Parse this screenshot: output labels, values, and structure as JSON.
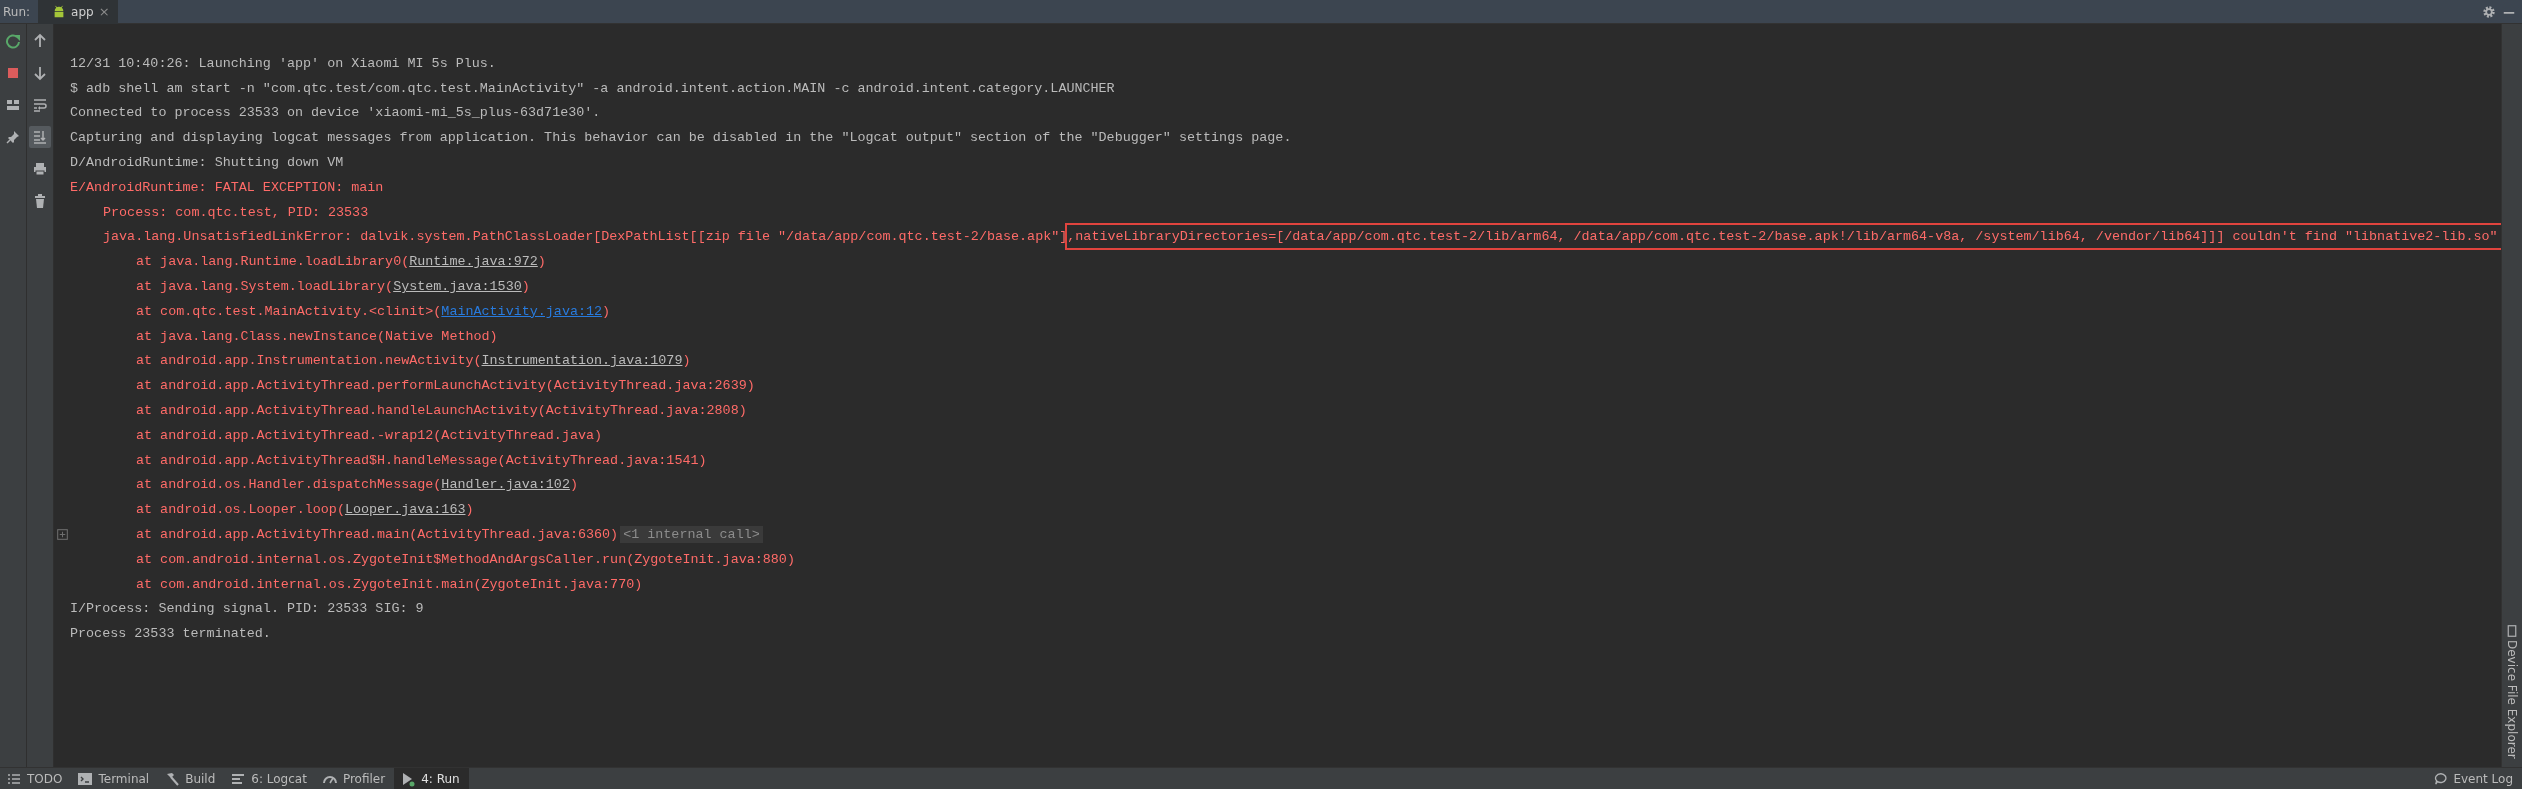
{
  "top_bar": {
    "label": "Run:",
    "tab": {
      "title": "app",
      "close": "×"
    }
  },
  "toolbar_left": [
    {
      "kind": "rerun",
      "selected": false
    },
    {
      "kind": "stop",
      "selected": false
    },
    {
      "kind": "layout",
      "selected": false
    },
    {
      "kind": "pin",
      "selected": false
    }
  ],
  "toolbar_right": [
    {
      "kind": "up",
      "selected": false
    },
    {
      "kind": "down",
      "selected": false
    },
    {
      "kind": "wrap",
      "selected": false
    },
    {
      "kind": "scroll-end",
      "selected": true
    },
    {
      "kind": "print",
      "selected": false
    },
    {
      "kind": "trash",
      "selected": false
    }
  ],
  "console": [
    {
      "kind": "info",
      "parts": [
        {
          "text": "12/31 10:40:26: Launching 'app' on Xiaomi MI 5s Plus."
        }
      ]
    },
    {
      "kind": "info",
      "parts": [
        {
          "text": "$ adb shell am start -n \"com.qtc.test/com.qtc.test.MainActivity\" -a android.intent.action.MAIN -c android.intent.category.LAUNCHER"
        }
      ]
    },
    {
      "kind": "info",
      "parts": [
        {
          "text": "Connected to process 23533 on device 'xiaomi-mi_5s_plus-63d71e30'."
        }
      ]
    },
    {
      "kind": "info",
      "parts": [
        {
          "text": "Capturing and displaying logcat messages from application. This behavior can be disabled in the \"Logcat output\" section of the \"Debugger\" settings page."
        }
      ]
    },
    {
      "kind": "info",
      "parts": [
        {
          "text": "D/AndroidRuntime: Shutting down VM"
        }
      ]
    },
    {
      "kind": "error",
      "parts": [
        {
          "text": "E/AndroidRuntime: FATAL EXCEPTION: main"
        }
      ]
    },
    {
      "kind": "detail",
      "parts": [
        {
          "text": "Process: com.qtc.test, PID: 23533"
        }
      ]
    },
    {
      "kind": "detail",
      "parts": [
        {
          "text": "java.lang.UnsatisfiedLinkError: dalvik.system.PathClassLoader[DexPathList[[zip file \"/data/app/com.qtc.test-2/base.apk\"]"
        },
        {
          "text": ",nativeLibraryDirectories=[/data/app/com.qtc.test-2/lib/arm64, /data/app/com.qtc.test-2/base.apk!/lib/arm64-v8a, /system/lib64, /vendor/lib64]]] couldn't find \"libnative2-lib.so\"",
          "kind": "highlight"
        }
      ]
    },
    {
      "kind": "frame",
      "parts": [
        {
          "text": "at java.lang.Runtime.loadLibrary0("
        },
        {
          "text": "Runtime.java:972",
          "kind": "link"
        },
        {
          "text": ")"
        }
      ]
    },
    {
      "kind": "frame",
      "parts": [
        {
          "text": "at java.lang.System.loadLibrary("
        },
        {
          "text": "System.java:1530",
          "kind": "link"
        },
        {
          "text": ")"
        }
      ]
    },
    {
      "kind": "frame",
      "parts": [
        {
          "text": "at com.qtc.test.MainActivity.<clinit>("
        },
        {
          "text": "MainActivity.java:12",
          "kind": "project-link"
        },
        {
          "text": ")"
        }
      ]
    },
    {
      "kind": "frame",
      "parts": [
        {
          "text": "at java.lang.Class.newInstance(Native Method)"
        }
      ]
    },
    {
      "kind": "frame",
      "parts": [
        {
          "text": "at android.app.Instrumentation.newActivity("
        },
        {
          "text": "Instrumentation.java:1079",
          "kind": "link"
        },
        {
          "text": ")"
        }
      ]
    },
    {
      "kind": "frame",
      "parts": [
        {
          "text": "at android.app.ActivityThread.performLaunchActivity(ActivityThread.java:2639)"
        }
      ]
    },
    {
      "kind": "frame",
      "parts": [
        {
          "text": "at android.app.ActivityThread.handleLaunchActivity(ActivityThread.java:2808)"
        }
      ]
    },
    {
      "kind": "frame",
      "parts": [
        {
          "text": "at android.app.ActivityThread.-wrap12(ActivityThread.java)"
        }
      ]
    },
    {
      "kind": "frame",
      "parts": [
        {
          "text": "at android.app.ActivityThread$H.handleMessage(ActivityThread.java:1541)"
        }
      ]
    },
    {
      "kind": "frame",
      "parts": [
        {
          "text": "at android.os.Handler.dispatchMessage("
        },
        {
          "text": "Handler.java:102",
          "kind": "link"
        },
        {
          "text": ")"
        }
      ]
    },
    {
      "kind": "frame",
      "parts": [
        {
          "text": "at android.os.Looper.loop("
        },
        {
          "text": "Looper.java:163",
          "kind": "link"
        },
        {
          "text": ")"
        }
      ]
    },
    {
      "kind": "frame",
      "fold": true,
      "parts": [
        {
          "text": "at android.app.ActivityThread.main(ActivityThread.java:6360)"
        },
        {
          "text": "<1 internal call>",
          "kind": "folded"
        }
      ]
    },
    {
      "kind": "frame",
      "parts": [
        {
          "text": "at com.android.internal.os.ZygoteInit$MethodAndArgsCaller.run(ZygoteInit.java:880)"
        }
      ]
    },
    {
      "kind": "frame",
      "parts": [
        {
          "text": "at com.android.internal.os.ZygoteInit.main(ZygoteInit.java:770)"
        }
      ]
    },
    {
      "kind": "info",
      "parts": [
        {
          "text": "I/Process: Sending signal. PID: 23533 SIG: 9"
        }
      ]
    },
    {
      "kind": "info",
      "parts": [
        {
          "text": "Process 23533 terminated."
        }
      ]
    }
  ],
  "side_strip": {
    "label": "Device File Explorer"
  },
  "bottom_bar": {
    "tabs": [
      {
        "kind": "todo",
        "label": "TODO",
        "selected": false
      },
      {
        "kind": "terminal",
        "label": "Terminal",
        "selected": false
      },
      {
        "kind": "build",
        "label": "Build",
        "selected": false
      },
      {
        "kind": "logcat",
        "label": "6: Logcat",
        "selected": false
      },
      {
        "kind": "profiler",
        "label": "Profiler",
        "selected": false
      },
      {
        "kind": "run",
        "label": "4: Run",
        "selected": true
      }
    ],
    "event_log": "Event Log"
  }
}
